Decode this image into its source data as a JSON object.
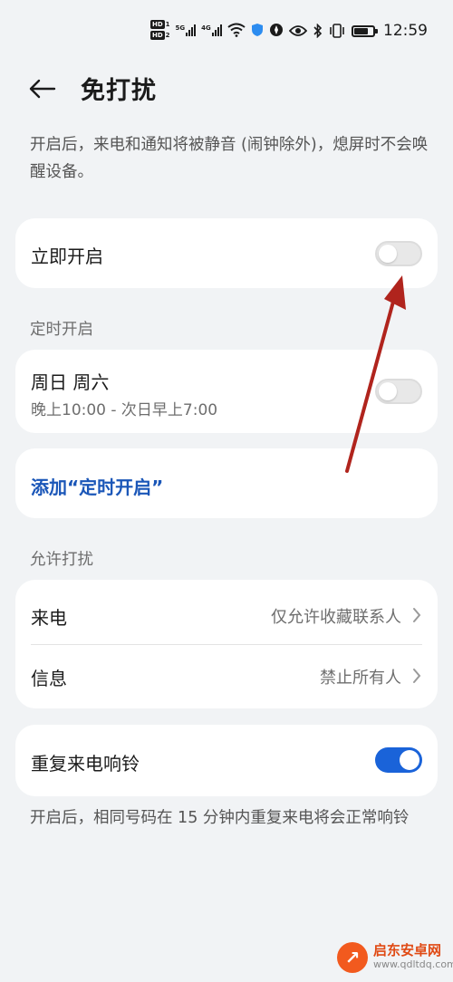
{
  "status_bar": {
    "hd1": "HD",
    "hd1_num": "1",
    "hd2": "HD",
    "hd2_num": "2",
    "net1": "5G",
    "net2": "4G",
    "time": "12:59",
    "icons": [
      "signal-icon",
      "wifi-icon",
      "shield-icon",
      "compass-icon",
      "eye-icon",
      "bluetooth-icon",
      "vibrate-icon",
      "battery-icon"
    ],
    "battery_level": 0.85
  },
  "header": {
    "title": "免打扰",
    "back_icon": "arrow-left-icon"
  },
  "description": "开启后，来电和通知将被静音 (闹钟除外)，熄屏时不会唤醒设备。",
  "immediate": {
    "label": "立即开启",
    "enabled": false
  },
  "schedule": {
    "section_title": "定时开启",
    "item": {
      "days": "周日 周六",
      "time": "晚上10:00 - 次日早上7:00",
      "enabled": false
    },
    "add_label": "添加“定时开启”"
  },
  "allow": {
    "section_title": "允许打扰",
    "rows": [
      {
        "label": "来电",
        "value": "仅允许收藏联系人"
      },
      {
        "label": "信息",
        "value": "禁止所有人"
      }
    ]
  },
  "repeat_calls": {
    "label": "重复来电响铃",
    "enabled": true,
    "description": "开启后，相同号码在 15 分钟内重复来电将会正常响铃"
  },
  "watermark": {
    "name": "启东安卓网",
    "url": "www.qdltdq.com"
  },
  "colors": {
    "accent": "#1a63d9",
    "link": "#1a56b8",
    "background": "#f1f3f5",
    "annotation_arrow": "#b0241d"
  }
}
